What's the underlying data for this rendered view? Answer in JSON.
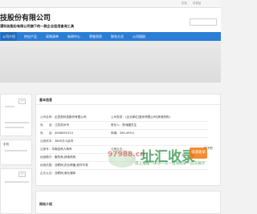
{
  "topbar": {
    "links": [
      "手机",
      "手机站"
    ]
  },
  "header": {
    "company_name": "技股份有限公司",
    "tagline": "溧科技股份有限公司旗下的一款企业信用查询工具"
  },
  "nav": {
    "items": [
      "公司介绍",
      "供应产品",
      "采购清单",
      "新闻中心",
      "荣誉资质",
      "联系方式",
      "公司相册"
    ],
    "active_index": 0
  },
  "sidebar": {
    "button_label": "一",
    "text_label": "手机"
  },
  "main": {
    "section_title": "基本信息",
    "rows": [
      [
        {
          "label": "公司名称：",
          "value": "企查查科技股份有限公司"
        },
        {
          "label": "公司类型：",
          "value": "(企业单位)股份有限公司(其他机构)"
        }
      ],
      [
        {
          "label": "电　　话：",
          "value": "江苏苏州市"
        },
        {
          "label": "联系人：",
          "value": "陈涛唐先生"
        }
      ],
      [
        {
          "label": "电　　话：",
          "value": "4006092313"
        },
        {
          "label": "邮编：",
          "value": "390-495人"
        }
      ],
      [
        {
          "label": "注册资本：",
          "value": "3800万人民币"
        },
        {
          "label": "",
          "value": ""
        }
      ],
      [
        {
          "label": "注册号：",
          "value": "华南自然人商号"
        },
        {
          "label": "注册企业：",
          "value": ""
        }
      ],
      [
        {
          "label": "经营模式：",
          "value": "服务商,其他机构"
        },
        {
          "label": "",
          "value": ""
        }
      ],
      [
        {
          "label": "经营范围：",
          "value": "互联网,农业种植,软件开发"
        },
        {
          "label": "",
          "value": ""
        }
      ],
      [
        {
          "label": "企业认证：",
          "value": "互联网,商业媒体"
        },
        {
          "label": "",
          "value": ""
        }
      ]
    ],
    "side_snippet": "旗下的",
    "bottom_title": "网站介绍"
  },
  "watermark": {
    "number": "97988.cn",
    "title": "址汇收录",
    "badge": "极速收录",
    "slogan": "提上推推一未访一次一自动收录一造天展示"
  },
  "colors": {
    "nav_bg": "#2b7ed6",
    "nav_active": "#1f6bbd",
    "watermark_green": "#1f8a3a",
    "badge_orange": "#f07a10"
  }
}
